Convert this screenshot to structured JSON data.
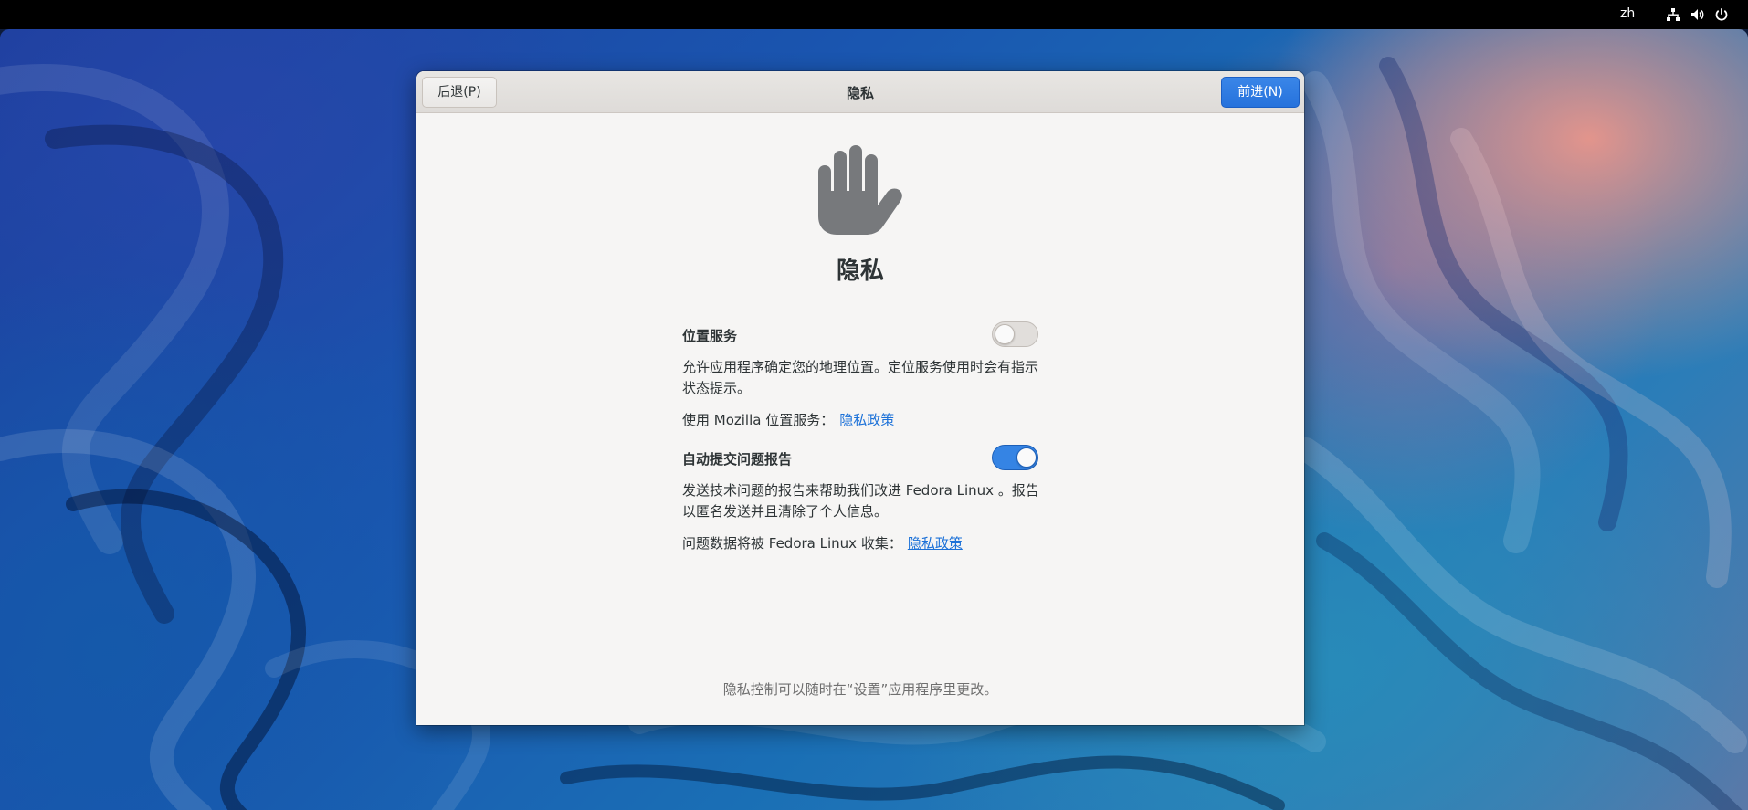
{
  "topbar": {
    "language": "zh",
    "icons": [
      "network-icon",
      "volume-icon",
      "power-icon"
    ]
  },
  "window": {
    "title": "隐私",
    "back_button": "后退(P)",
    "next_button": "前进(N)"
  },
  "page": {
    "icon": "hand-icon",
    "heading": "隐私",
    "location": {
      "title": "位置服务",
      "enabled": false,
      "description": "允许应用程序确定您的地理位置。定位服务使用时会有指示状态提示。",
      "policy_prefix": "使用 Mozilla 位置服务：",
      "policy_link": "隐私政策"
    },
    "reporting": {
      "title": "自动提交问题报告",
      "enabled": true,
      "description": "发送技术问题的报告来帮助我们改进 Fedora Linux 。报告以匿名发送并且清除了个人信息。",
      "policy_prefix": "问题数据将被 Fedora Linux 收集：",
      "policy_link": "隐私政策"
    },
    "footer": "隐私控制可以随时在“设置”应用程序里更改。"
  },
  "colors": {
    "accent": "#3584e4",
    "link": "#1c71d8",
    "topbar": "#000000"
  }
}
